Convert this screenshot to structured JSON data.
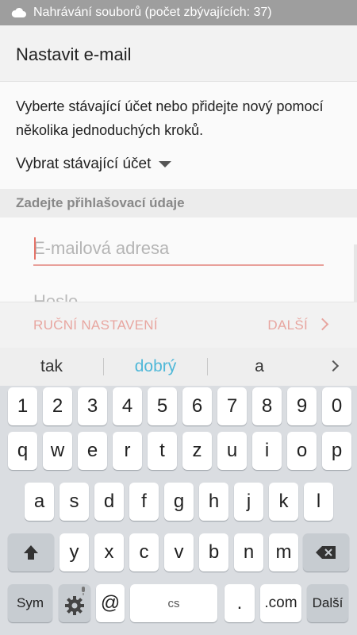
{
  "status_bar": {
    "text": "Nahrávání souborů (počet zbývajících: 37)",
    "icon": "cloud-upload-icon"
  },
  "header": {
    "title": "Nastavit e-mail"
  },
  "intro": "Vyberte stávající účet nebo přidejte nový pomocí několika jednoduchých kroků.",
  "account_select": {
    "label": "Vybrat stávající účet"
  },
  "credentials": {
    "section_title": "Zadejte přihlašovací údaje",
    "email_placeholder": "E-mailová adresa",
    "email_value": "",
    "password_hint_partial": "Heslo"
  },
  "actions": {
    "manual_setup": "RUČNÍ NASTAVENÍ",
    "next": "DALŠÍ"
  },
  "suggestions": [
    "tak",
    "dobrý",
    "a"
  ],
  "keyboard": {
    "row_numbers": [
      "1",
      "2",
      "3",
      "4",
      "5",
      "6",
      "7",
      "8",
      "9",
      "0"
    ],
    "row1": [
      "q",
      "w",
      "e",
      "r",
      "t",
      "z",
      "u",
      "i",
      "o",
      "p"
    ],
    "row2": [
      "a",
      "s",
      "d",
      "f",
      "g",
      "h",
      "j",
      "k",
      "l"
    ],
    "row3": [
      "y",
      "x",
      "c",
      "v",
      "b",
      "n",
      "m"
    ],
    "sym": "Sym",
    "at": "@",
    "space_lang": "cs",
    "period": ".",
    "dotcom": ".com",
    "enter": "Další"
  },
  "colors": {
    "accent_link": "#4fb8d8",
    "email_underline": "#e8a09a",
    "action_text": "#e8a6a0"
  }
}
